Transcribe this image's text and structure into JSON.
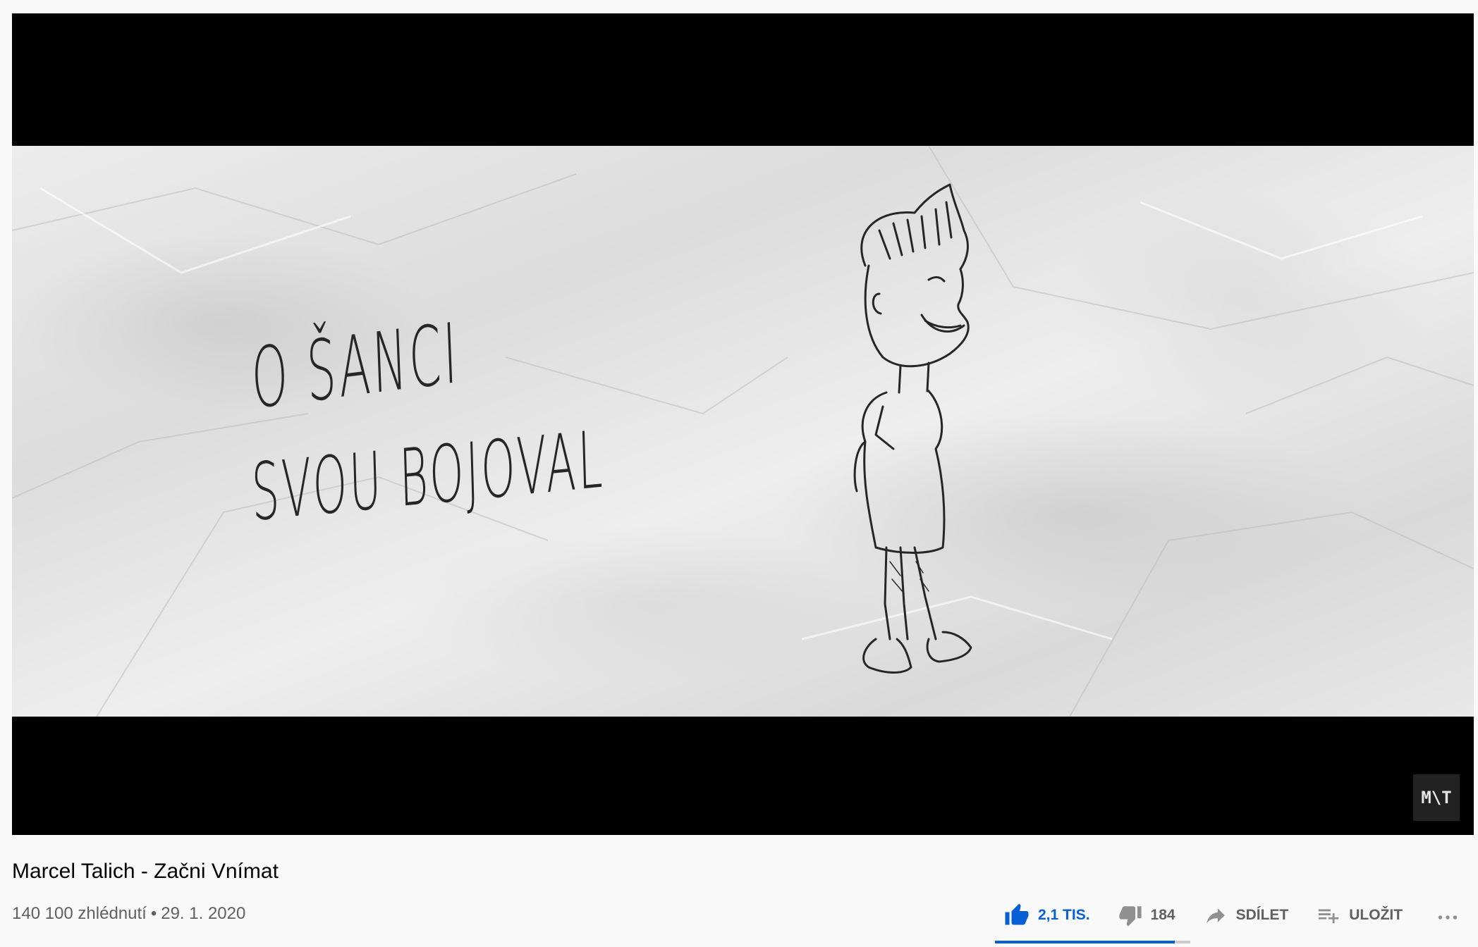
{
  "player": {
    "lyrics": {
      "line1": "O ŠANCI",
      "line2": "SVOU BOJOVAL"
    },
    "watermark": "M\\T",
    "frame_scene": "hand-drawn-character-on-crumpled-paper"
  },
  "video": {
    "title": "Marcel Talich - Začni Vnímat",
    "views": "140 100 zhlédnutí",
    "separator": "•",
    "date": "29. 1. 2020"
  },
  "actions": {
    "like": {
      "label": "2,1 TIS.",
      "icon": "thumbs-up-icon",
      "active": true
    },
    "dislike": {
      "label": "184",
      "icon": "thumbs-down-icon"
    },
    "share": {
      "label": "SDÍLET",
      "icon": "share-arrow-icon"
    },
    "save": {
      "label": "ULOŽIT",
      "icon": "playlist-add-icon"
    },
    "more": {
      "icon": "more-horizontal-icon"
    }
  },
  "sentiment": {
    "like_ratio": 0.92
  },
  "colors": {
    "accent": "#065fd4",
    "secondary_text": "#606060",
    "primary_text": "#030303",
    "background": "#f9f9f9"
  }
}
